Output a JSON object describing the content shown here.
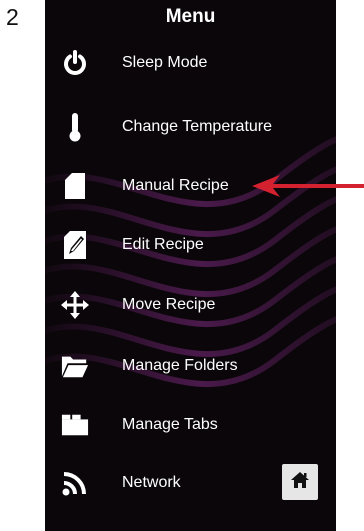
{
  "step_number": "2",
  "menu": {
    "title": "Menu",
    "items": [
      {
        "label": "Sleep Mode",
        "icon": "power-icon"
      },
      {
        "label": "Change Temperature",
        "icon": "thermometer-icon"
      },
      {
        "label": "Manual Recipe",
        "icon": "document-icon"
      },
      {
        "label": "Edit Recipe",
        "icon": "edit-document-icon"
      },
      {
        "label": "Move Recipe",
        "icon": "move-arrows-icon"
      },
      {
        "label": "Manage Folders",
        "icon": "folder-icon"
      },
      {
        "label": "Manage Tabs",
        "icon": "tabs-icon"
      },
      {
        "label": "Network",
        "icon": "wifi-signal-icon"
      }
    ],
    "home_icon": "home-icon"
  },
  "colors": {
    "screen_background": "#0a0609",
    "wave_accent": "#5a1f5c",
    "text": "#ffffff",
    "callout_arrow": "#d4212f",
    "home_button_bg": "#e6e6e6"
  }
}
